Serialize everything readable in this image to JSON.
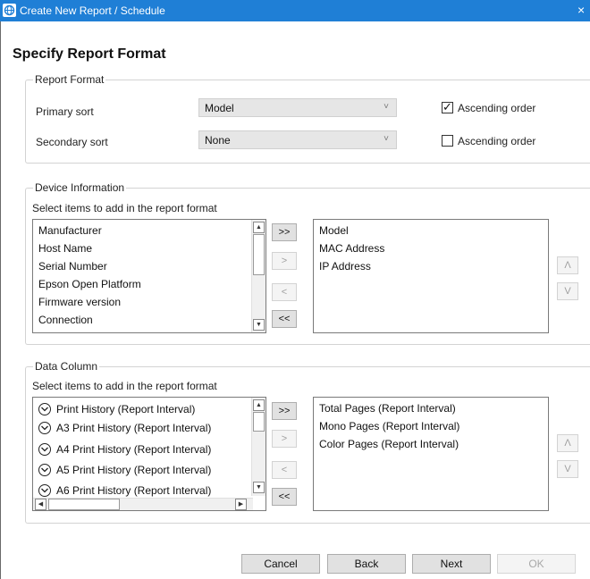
{
  "window": {
    "title": "Create New Report / Schedule",
    "close_glyph": "×"
  },
  "heading": "Specify Report Format",
  "report_format": {
    "group_title": "Report Format",
    "primary_sort": {
      "label": "Primary sort",
      "value": "Model",
      "ascending_label": "Ascending order",
      "ascending_checked": true
    },
    "secondary_sort": {
      "label": "Secondary sort",
      "value": "None",
      "ascending_label": "Ascending order",
      "ascending_checked": false
    }
  },
  "device_information": {
    "group_title": "Device Information",
    "instruction": "Select items to add in the report format",
    "available": [
      "Manufacturer",
      "Host Name",
      "Serial Number",
      "Epson Open Platform",
      "Firmware version",
      "Connection"
    ],
    "selected": [
      "Model",
      "MAC Address",
      "IP Address"
    ],
    "buttons": {
      "add_all": ">>",
      "add": ">",
      "remove": "<",
      "remove_all": "<<"
    },
    "order": {
      "up": "Λ",
      "down": "V"
    }
  },
  "data_column": {
    "group_title": "Data Column",
    "instruction": "Select items to add in the report format",
    "available": [
      "Print History (Report Interval)",
      "A3 Print History (Report Interval)",
      "A4 Print History (Report Interval)",
      "A5 Print History (Report Interval)",
      "A6 Print History (Report Interval)"
    ],
    "selected": [
      "Total Pages (Report Interval)",
      "Mono Pages (Report Interval)",
      "Color Pages (Report Interval)"
    ],
    "buttons": {
      "add_all": ">>",
      "add": ">",
      "remove": "<",
      "remove_all": "<<"
    },
    "order": {
      "up": "Λ",
      "down": "V"
    }
  },
  "footer": {
    "cancel": "Cancel",
    "back": "Back",
    "next": "Next",
    "ok": "OK"
  },
  "colors": {
    "titlebar": "#1f7fd6",
    "button": "#e1e1e1",
    "group_border": "#d3d3d3"
  }
}
